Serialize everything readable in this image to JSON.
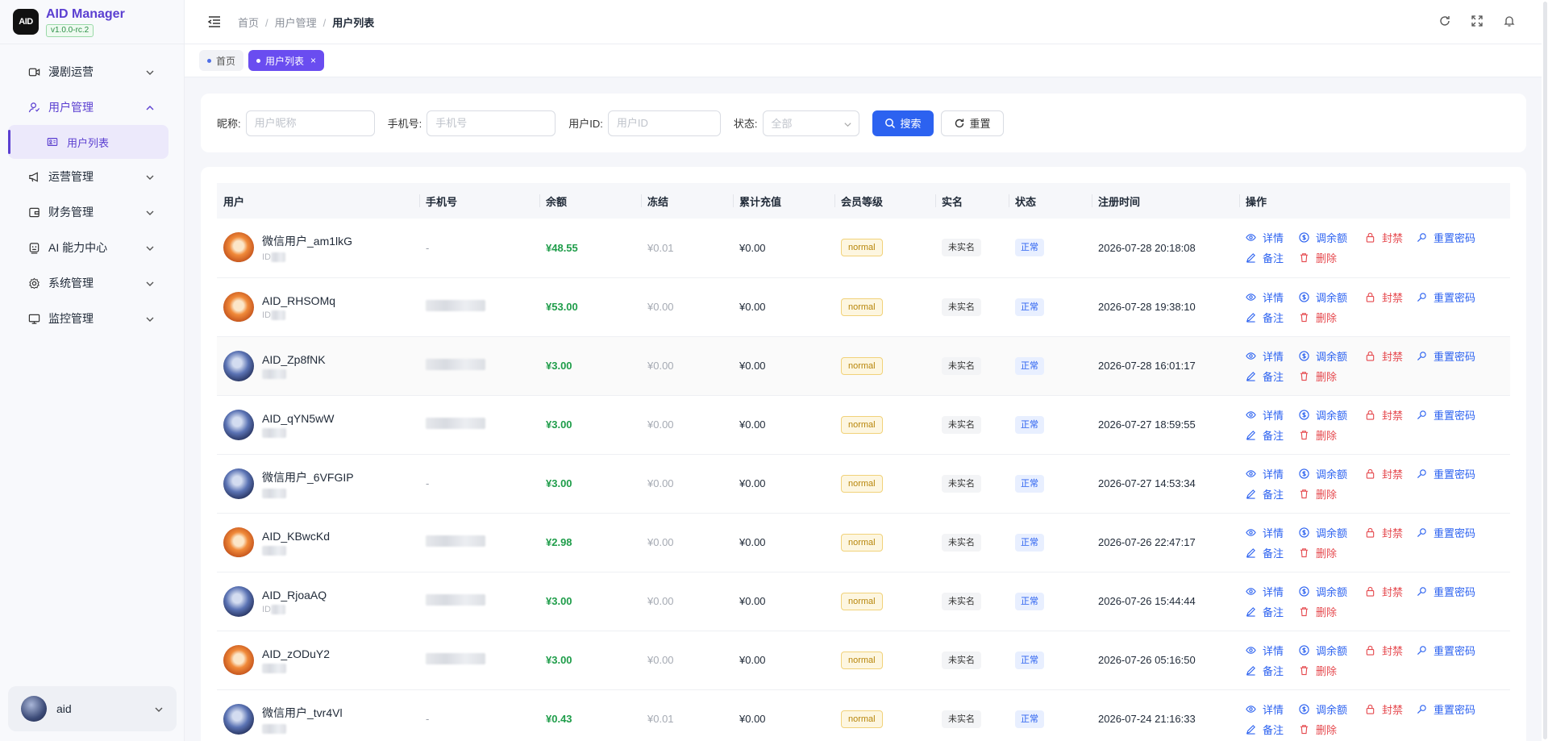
{
  "app": {
    "logo_text": "AID",
    "title": "AID Manager",
    "version": "v1.0.0-rc.2"
  },
  "sidebar": {
    "items": [
      {
        "label": "漫剧运营",
        "icon": "video-icon",
        "open": false
      },
      {
        "label": "用户管理",
        "icon": "user-icon",
        "open": true,
        "children": [
          {
            "label": "用户列表",
            "icon": "id-card-icon",
            "active": true
          }
        ]
      },
      {
        "label": "运营管理",
        "icon": "megaphone-icon",
        "open": false
      },
      {
        "label": "财务管理",
        "icon": "wallet-icon",
        "open": false
      },
      {
        "label": "AI 能力中心",
        "icon": "robot-icon",
        "open": false
      },
      {
        "label": "系统管理",
        "icon": "gear-icon",
        "open": false
      },
      {
        "label": "监控管理",
        "icon": "monitor-icon",
        "open": false
      }
    ],
    "user": {
      "name": "aid"
    }
  },
  "header": {
    "breadcrumb": [
      "首页",
      "用户管理",
      "用户列表"
    ]
  },
  "tabs": [
    {
      "label": "首页",
      "active": false
    },
    {
      "label": "用户列表",
      "active": true,
      "close": "×"
    }
  ],
  "search": {
    "nickname_label": "昵称:",
    "nickname_placeholder": "用户昵称",
    "phone_label": "手机号:",
    "phone_placeholder": "手机号",
    "userid_label": "用户ID:",
    "userid_placeholder": "用户ID",
    "status_label": "状态:",
    "status_value": "全部",
    "search_button": "搜索",
    "reset_button": "重置"
  },
  "table": {
    "columns": [
      "用户",
      "手机号",
      "余额",
      "冻结",
      "累计充值",
      "会员等级",
      "实名",
      "状态",
      "注册时间",
      "操作"
    ],
    "actions": {
      "detail": "详情",
      "adjust": "调余额",
      "ban": "封禁",
      "reset_pwd": "重置密码",
      "remark": "备注",
      "delete": "删除"
    },
    "rows": [
      {
        "name": "微信用户_am1lkG",
        "id_prefix": "ID",
        "avatar": "fox",
        "phone": "-",
        "balance": "¥48.55",
        "frozen": "¥0.01",
        "total": "¥0.00",
        "level": "normal",
        "real": "未实名",
        "status": "正常",
        "time": "2026-07-28 20:18:08"
      },
      {
        "name": "AID_RHSOMq",
        "id_prefix": "ID",
        "avatar": "fox",
        "phone": "",
        "balance": "¥53.00",
        "frozen": "¥0.00",
        "total": "¥0.00",
        "level": "normal",
        "real": "未实名",
        "status": "正常",
        "time": "2026-07-28 19:38:10"
      },
      {
        "name": "AID_Zp8fNK",
        "id_prefix": "",
        "avatar": "blue",
        "phone": "",
        "balance": "¥3.00",
        "frozen": "¥0.00",
        "total": "¥0.00",
        "level": "normal",
        "real": "未实名",
        "status": "正常",
        "time": "2026-07-28 16:01:17"
      },
      {
        "name": "AID_qYN5wW",
        "id_prefix": "",
        "avatar": "blue",
        "phone": "",
        "balance": "¥3.00",
        "frozen": "¥0.00",
        "total": "¥0.00",
        "level": "normal",
        "real": "未实名",
        "status": "正常",
        "time": "2026-07-27 18:59:55"
      },
      {
        "name": "微信用户_6VFGIP",
        "id_prefix": "",
        "avatar": "blue",
        "phone": "-",
        "balance": "¥3.00",
        "frozen": "¥0.00",
        "total": "¥0.00",
        "level": "normal",
        "real": "未实名",
        "status": "正常",
        "time": "2026-07-27 14:53:34"
      },
      {
        "name": "AID_KBwcKd",
        "id_prefix": "",
        "avatar": "fox",
        "phone": "",
        "balance": "¥2.98",
        "frozen": "¥0.00",
        "total": "¥0.00",
        "level": "normal",
        "real": "未实名",
        "status": "正常",
        "time": "2026-07-26 22:47:17"
      },
      {
        "name": "AID_RjoaAQ",
        "id_prefix": "ID",
        "avatar": "blue",
        "phone": "",
        "balance": "¥3.00",
        "frozen": "¥0.00",
        "total": "¥0.00",
        "level": "normal",
        "real": "未实名",
        "status": "正常",
        "time": "2026-07-26 15:44:44"
      },
      {
        "name": "AID_zODuY2",
        "id_prefix": "",
        "avatar": "fox",
        "phone": "",
        "balance": "¥3.00",
        "frozen": "¥0.00",
        "total": "¥0.00",
        "level": "normal",
        "real": "未实名",
        "status": "正常",
        "time": "2026-07-26 05:16:50"
      },
      {
        "name": "微信用户_tvr4Vl",
        "id_prefix": "",
        "avatar": "blue",
        "phone": "-",
        "balance": "¥0.43",
        "frozen": "¥0.01",
        "total": "¥0.00",
        "level": "normal",
        "real": "未实名",
        "status": "正常",
        "time": "2026-07-24 21:16:33"
      }
    ]
  },
  "colors": {
    "brand": "#5b3fd1",
    "primary": "#2c62f0",
    "success": "#1f9d4a",
    "danger": "#e5484d",
    "warning": "#b8860b"
  }
}
